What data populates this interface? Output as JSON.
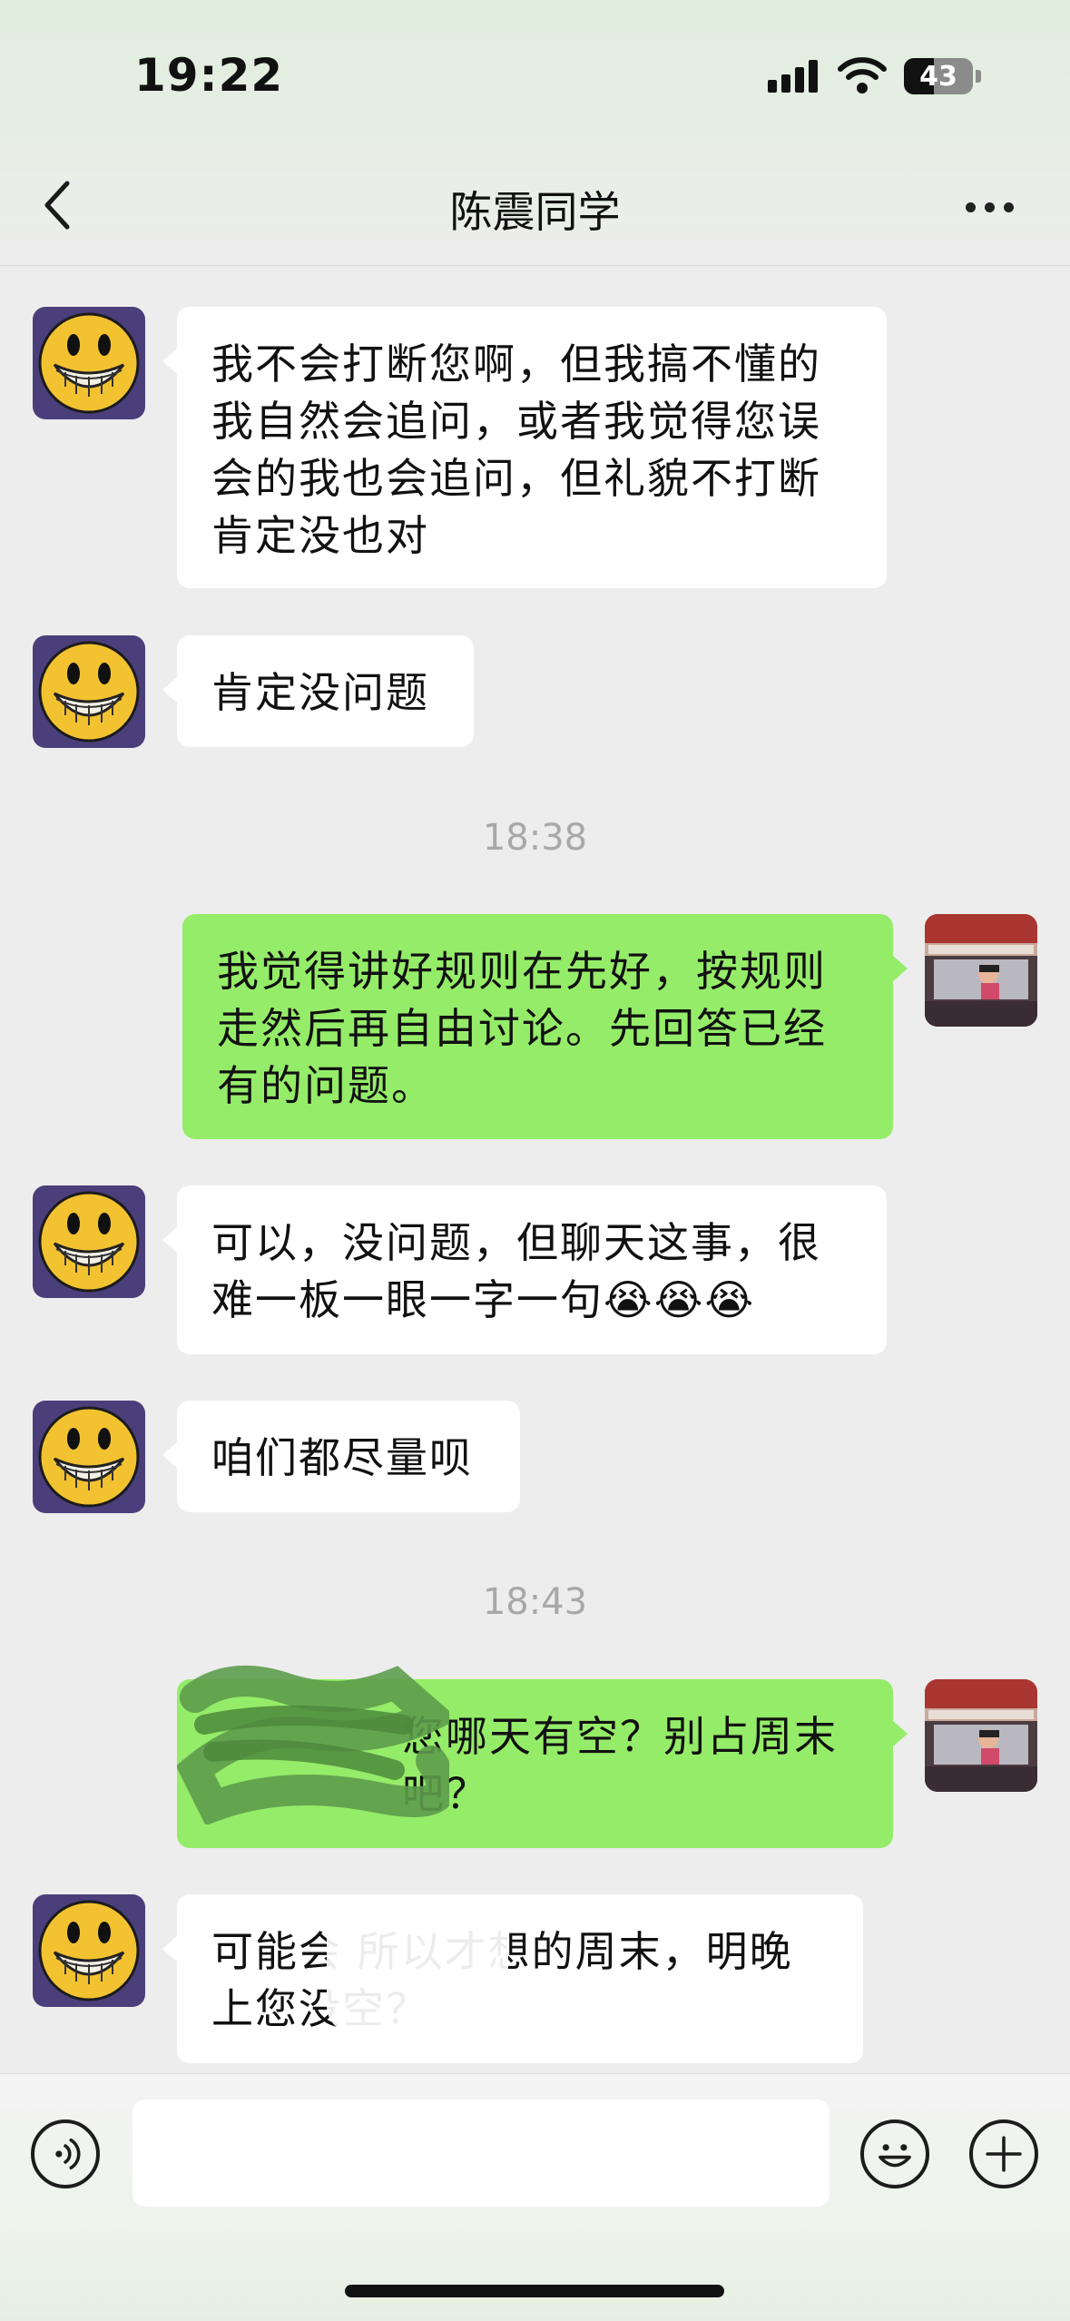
{
  "status_bar": {
    "time": "19:22",
    "battery_level": "43"
  },
  "nav": {
    "title": "陈震同学"
  },
  "messages": [
    {
      "side": "in",
      "text": "我不会打断您啊，但我搞不懂的我自然会追问，或者我觉得您误会的我也会追问，但礼貌不打断肯定没也对"
    },
    {
      "side": "in",
      "text": "肯定没问题"
    },
    {
      "timestamp": "18:38"
    },
    {
      "side": "out",
      "text": "我觉得讲好规则在先好，按规则走然后再自由讨论。先回答已经有的问题。"
    },
    {
      "side": "in",
      "text": "可以，没问题，但聊天这事，很难一板一眼一字一句😭😭😭"
    },
    {
      "side": "in",
      "text": "咱们都尽量呗"
    },
    {
      "timestamp": "18:43"
    },
    {
      "side": "out",
      "text": "您哪天有空？别占周末吧？"
    },
    {
      "side": "in",
      "text": "可能会 所以才想的周末，明晚上您没空？"
    }
  ],
  "input": {
    "value": ""
  },
  "colors": {
    "outgoing_bubble": "#95ec69",
    "incoming_bubble": "#ffffff",
    "background": "#ededed"
  },
  "icons": [
    "back-icon",
    "more-icon",
    "voice-icon",
    "emoji-icon",
    "plus-icon"
  ]
}
